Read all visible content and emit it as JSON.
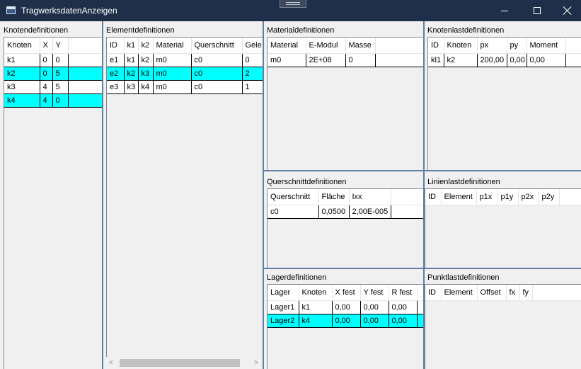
{
  "window": {
    "title": "TragwerksdatenAnzeigen"
  },
  "sections": {
    "knoten": {
      "title": "Knotendefinitionen",
      "columns": [
        "Knoten",
        "X",
        "Y"
      ],
      "rows": [
        {
          "cells": [
            "k1",
            "0",
            "0"
          ],
          "selected": false
        },
        {
          "cells": [
            "k2",
            "0",
            "5"
          ],
          "selected": true
        },
        {
          "cells": [
            "k3",
            "4",
            "5"
          ],
          "selected": false
        },
        {
          "cells": [
            "k4",
            "4",
            "0"
          ],
          "selected": true
        }
      ]
    },
    "element": {
      "title": "Elementdefinitionen",
      "columns": [
        "ID",
        "k1",
        "k2",
        "Material",
        "Querschnitt",
        "Gele"
      ],
      "rows": [
        {
          "cells": [
            "e1",
            "k1",
            "k2",
            "m0",
            "c0",
            "0"
          ],
          "selected": false
        },
        {
          "cells": [
            "e2",
            "k2",
            "k3",
            "m0",
            "c0",
            "2"
          ],
          "selected": true
        },
        {
          "cells": [
            "e3",
            "k3",
            "k4",
            "m0",
            "c0",
            "1"
          ],
          "selected": false
        }
      ]
    },
    "material": {
      "title": "Materialdefinitionen",
      "columns": [
        "Material",
        "E-Modul",
        "Masse"
      ],
      "rows": [
        {
          "cells": [
            "m0",
            "2E+08",
            "0"
          ],
          "selected": false
        }
      ]
    },
    "knotenlast": {
      "title": "Knotenlastdefinitionen",
      "columns": [
        "ID",
        "Knoten",
        "px",
        "py",
        "Moment"
      ],
      "rows": [
        {
          "cells": [
            "kl1",
            "k2",
            "200,00",
            "0,00",
            "0,00"
          ],
          "selected": false
        }
      ]
    },
    "querschnitt": {
      "title": "Querschnittdefinitionen",
      "columns": [
        "Querschnitt",
        "Fläche",
        "Ixx"
      ],
      "rows": [
        {
          "cells": [
            "c0",
            "0,0500",
            "2,00E-005"
          ],
          "selected": false
        }
      ]
    },
    "linienlast": {
      "title": "Linienlastdefinitionen",
      "columns": [
        "ID",
        "Element",
        "p1x",
        "p1y",
        "p2x",
        "p2y"
      ],
      "rows": []
    },
    "lager": {
      "title": "Lagerdefinitionen",
      "columns": [
        "Lager",
        "Knoten",
        "X fest",
        "Y fest",
        "R fest"
      ],
      "rows": [
        {
          "cells": [
            "Lager1",
            "k1",
            "0,00",
            "0,00",
            "0,00"
          ],
          "selected": false
        },
        {
          "cells": [
            "Lager2",
            "k4",
            "0,00",
            "0,00",
            "0,00"
          ],
          "selected": true
        }
      ]
    },
    "punktlast": {
      "title": "Punktlastdefinitionen",
      "columns": [
        "ID",
        "Element",
        "Offset",
        "fx",
        "fy"
      ],
      "rows": []
    }
  }
}
